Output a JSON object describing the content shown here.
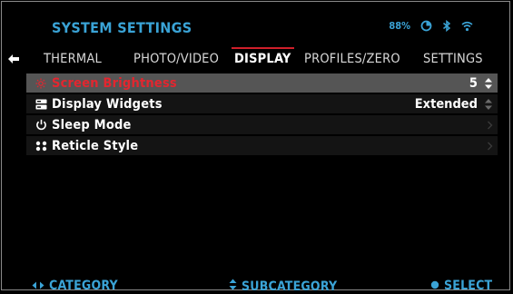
{
  "header": {
    "title": "SYSTEM SETTINGS",
    "battery_text": "88%",
    "icons": [
      "battery-icon",
      "bluetooth-icon",
      "wifi-icon"
    ]
  },
  "tabs": [
    {
      "label": "THERMAL",
      "active": false
    },
    {
      "label": "PHOTO/VIDEO",
      "active": false
    },
    {
      "label": "DISPLAY",
      "active": true
    },
    {
      "label": "PROFILES/ZERO",
      "active": false
    },
    {
      "label": "SETTINGS",
      "active": false
    }
  ],
  "menu": [
    {
      "label": "Screen Brightness",
      "value": "5",
      "icon": "brightness-icon",
      "selected": true,
      "control": "updown"
    },
    {
      "label": "Display Widgets",
      "value": "Extended",
      "icon": "widgets-icon",
      "selected": false,
      "control": "updown"
    },
    {
      "label": "Sleep Mode",
      "value": "",
      "icon": "power-icon",
      "selected": false,
      "control": "chevron"
    },
    {
      "label": "Reticle Style",
      "value": "",
      "icon": "reticle-icon",
      "selected": false,
      "control": "chevron"
    }
  ],
  "footer": {
    "category": "CATEGORY",
    "subcategory": "SUBCATEGORY",
    "select": "SELECT"
  },
  "colors": {
    "accent": "#3aa3d6",
    "selected_text": "#e3262f",
    "active_tab_line": "#d01f2a",
    "selected_row_bg": "#555555"
  }
}
